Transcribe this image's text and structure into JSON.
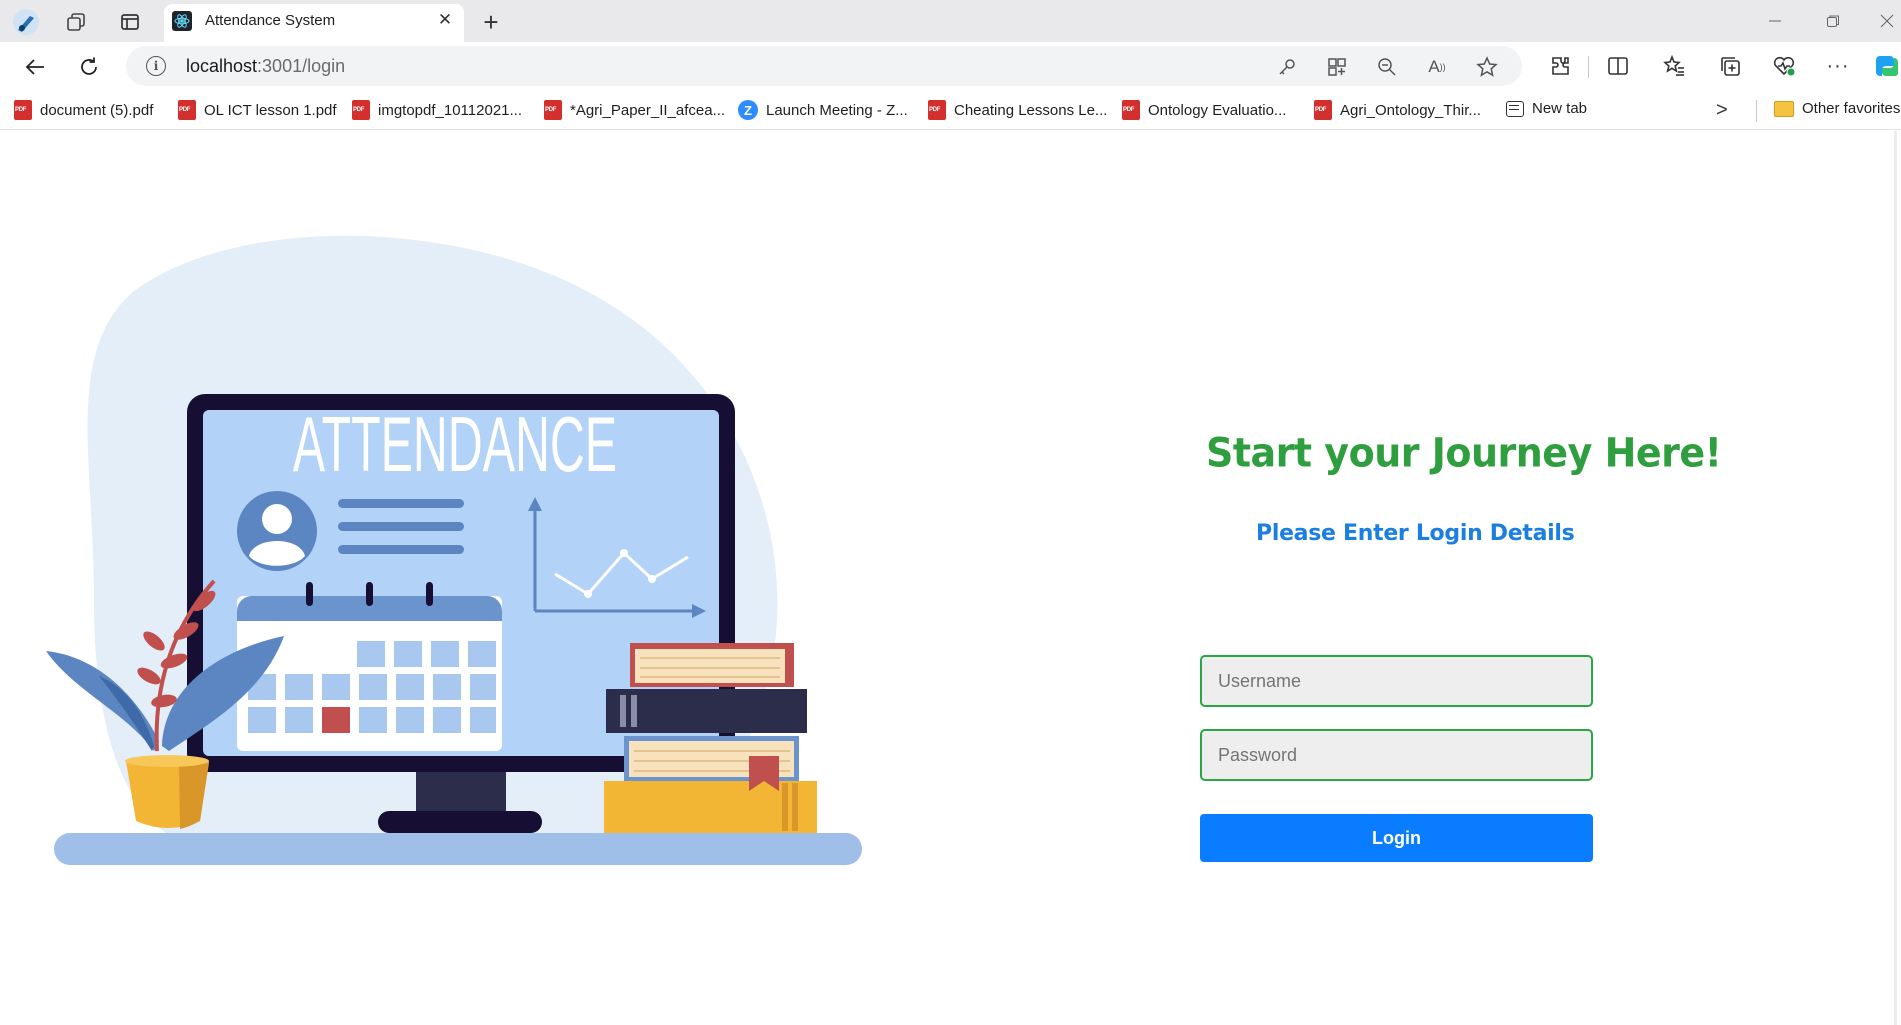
{
  "browser": {
    "tab": {
      "title": "Attendance System",
      "close_glyph": "✕"
    },
    "new_tab_glyph": "+",
    "address": {
      "host": "localhost",
      "path": ":3001/login"
    },
    "bookmarks": [
      {
        "label": "document (5).pdf",
        "icon": "pdf-icon"
      },
      {
        "label": "OL ICT lesson 1.pdf",
        "icon": "pdf-icon"
      },
      {
        "label": "imgtopdf_10112021...",
        "icon": "pdf-icon"
      },
      {
        "label": "*Agri_Paper_II_afcea...",
        "icon": "pdf-icon"
      },
      {
        "label": "Launch Meeting - Z...",
        "icon": "zoom-icon"
      },
      {
        "label": "Cheating Lessons Le...",
        "icon": "pdf-icon"
      },
      {
        "label": "Ontology Evaluatio...",
        "icon": "pdf-icon"
      },
      {
        "label": "Agri_Ontology_Thir...",
        "icon": "pdf-icon"
      },
      {
        "label": "New tab",
        "icon": "new-tab-icon"
      }
    ],
    "more_bookmarks_glyph": ">",
    "other_favorites": "Other favorites"
  },
  "illustration": {
    "screen_text": "ATTENDANCE"
  },
  "login": {
    "title": "Start your Journey Here!",
    "subtitle": "Please Enter Login Details",
    "username_placeholder": "Username",
    "password_placeholder": "Password",
    "button_label": "Login"
  },
  "colors": {
    "title_green": "#2e9e3e",
    "subtitle_blue": "#1a7fe0",
    "input_border": "#28a745",
    "button_blue": "#0a7cff"
  }
}
